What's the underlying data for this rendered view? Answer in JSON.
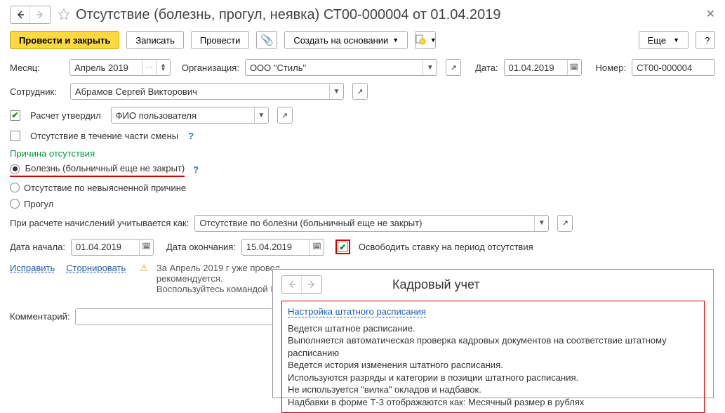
{
  "title": "Отсутствие (болезнь, прогул, неявка) СТ00-000004 от 01.04.2019",
  "toolbar": {
    "post_close": "Провести и закрыть",
    "save": "Записать",
    "post": "Провести",
    "create_based": "Создать на основании",
    "more": "Еще",
    "help": "?"
  },
  "fields": {
    "month_label": "Месяц:",
    "month_value": "Апрель 2019",
    "org_label": "Организация:",
    "org_value": "ООО \"Стиль\"",
    "date_label": "Дата:",
    "date_value": "01.04.2019",
    "number_label": "Номер:",
    "number_value": "СТ00-000004",
    "employee_label": "Сотрудник:",
    "employee_value": "Абрамов Сергей Викторович",
    "approved_label": "Расчет утвердил",
    "approved_value": "ФИО пользователя",
    "partial_shift_label": "Отсутствие в течение части смены"
  },
  "reason": {
    "section": "Причина отсутствия",
    "r1": "Болезнь (больничный еще не закрыт)",
    "r2": "Отсутствие по невыясненной причине",
    "r3": "Прогул"
  },
  "calc_row": {
    "label": "При расчете начислений учитывается как:",
    "value": "Отсутствие по болезни (больничный еще не закрыт)"
  },
  "dates": {
    "start_label": "Дата начала:",
    "start_value": "01.04.2019",
    "end_label": "Дата окончания:",
    "end_value": "15.04.2019",
    "release_label": "Освободить ставку на период отсутствия"
  },
  "links": {
    "fix": "Исправить",
    "reverse": "Сторнировать"
  },
  "warning": {
    "line1": "За Апрель 2019 г уже провед",
    "line2": "рекомендуется.",
    "line3": "Воспользуйтесь командой И"
  },
  "comment_label": "Комментарий:",
  "popup": {
    "title": "Кадровый учет",
    "link": "Настройка штатного расписания",
    "p1": "Ведется штатное расписание.",
    "p2": "Выполняется автоматическая проверка кадровых документов на соответствие штатному расписанию",
    "p3": "Ведется история изменения штатного расписания.",
    "p4": "Используются разряды и категории в позиции штатного расписания.",
    "p5": "Не используется \"вилка\" окладов и надбавок.",
    "p6": "Надбавки в форме Т-3 отображаются как: Месячный размер в рублях"
  }
}
